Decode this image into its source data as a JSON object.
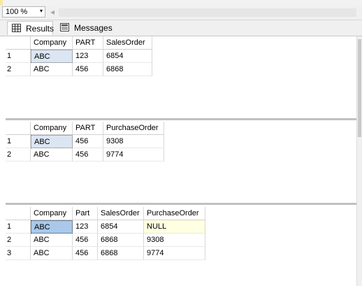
{
  "toolbar": {
    "zoom_value": "100 %",
    "zoom_arrow": "▾",
    "scroll_left_arrow": "◂"
  },
  "tabs": [
    {
      "label": "Results"
    },
    {
      "label": "Messages"
    }
  ],
  "grid1": {
    "columns": [
      "Company",
      "PART",
      "SalesOrder"
    ],
    "rows": [
      [
        "1",
        "ABC",
        "123",
        "6854"
      ],
      [
        "2",
        "ABC",
        "456",
        "6868"
      ]
    ]
  },
  "grid2": {
    "columns": [
      "Company",
      "PART",
      "PurchaseOrder"
    ],
    "rows": [
      [
        "1",
        "ABC",
        "456",
        "9308"
      ],
      [
        "2",
        "ABC",
        "456",
        "9774"
      ]
    ]
  },
  "grid3": {
    "columns": [
      "Company",
      "Part",
      "SalesOrder",
      "PurchaseOrder"
    ],
    "rows": [
      [
        "1",
        "ABC",
        "123",
        "6854",
        "NULL"
      ],
      [
        "2",
        "ABC",
        "456",
        "6868",
        "9308"
      ],
      [
        "3",
        "ABC",
        "456",
        "6868",
        "9774"
      ]
    ]
  }
}
